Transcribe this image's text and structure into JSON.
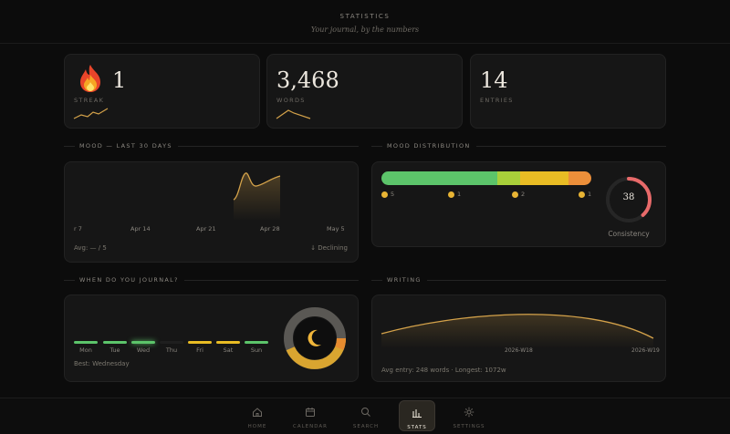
{
  "header": {
    "title": "STATISTICS",
    "subtitle": "Your journal, by the numbers"
  },
  "stats": {
    "streak": {
      "value": "1",
      "label": "STREAK",
      "icon": "flame-icon"
    },
    "words": {
      "value": "3,468",
      "label": "WORDS"
    },
    "entries": {
      "value": "14",
      "label": "ENTRIES"
    }
  },
  "mood": {
    "section_title": "MOOD — LAST 30 DAYS",
    "x_labels": [
      "r 7",
      "Apr 14",
      "Apr 21",
      "Apr 28",
      "May 5"
    ],
    "avg": "Avg: — / 5",
    "trend": "↓ Declining",
    "accent": "#d4a24a"
  },
  "distribution": {
    "section_title": "MOOD DISTRIBUTION",
    "segments": [
      {
        "count": "5",
        "color": "#5cc46a",
        "fraction": 0.55
      },
      {
        "count": "1",
        "color": "#a8cf3a",
        "fraction": 0.11
      },
      {
        "count": "2",
        "color": "#e9bc24",
        "fraction": 0.22
      },
      {
        "count": "1",
        "color": "#ec8f3a",
        "fraction": 0.11
      }
    ],
    "consistency_value": "38",
    "consistency_label": "Consistency",
    "consistency_color": "#e86a6a"
  },
  "when": {
    "section_title": "WHEN DO YOU JOURNAL?",
    "days": [
      {
        "label": "Mon",
        "color": "#5cc46a"
      },
      {
        "label": "Tue",
        "color": "#5cc46a"
      },
      {
        "label": "Wed",
        "color": "#5cc46a"
      },
      {
        "label": "Thu",
        "color": "#1f1f1f"
      },
      {
        "label": "Fri",
        "color": "#e9bc24"
      },
      {
        "label": "Sat",
        "color": "#e9bc24"
      },
      {
        "label": "Sun",
        "color": "#5cc46a"
      }
    ],
    "best": "Best: Wednesday"
  },
  "writing": {
    "section_title": "WRITING",
    "x_labels": [
      "2026-W18",
      "2026-W19"
    ],
    "summary": "Avg entry: 248 words · Longest: 1072w"
  },
  "nav": [
    {
      "label": "HOME",
      "icon": "home-icon"
    },
    {
      "label": "CALENDAR",
      "icon": "calendar-icon"
    },
    {
      "label": "SEARCH",
      "icon": "search-icon"
    },
    {
      "label": "STATS",
      "icon": "stats-icon",
      "active": true
    },
    {
      "label": "SETTINGS",
      "icon": "gear-icon"
    }
  ]
}
